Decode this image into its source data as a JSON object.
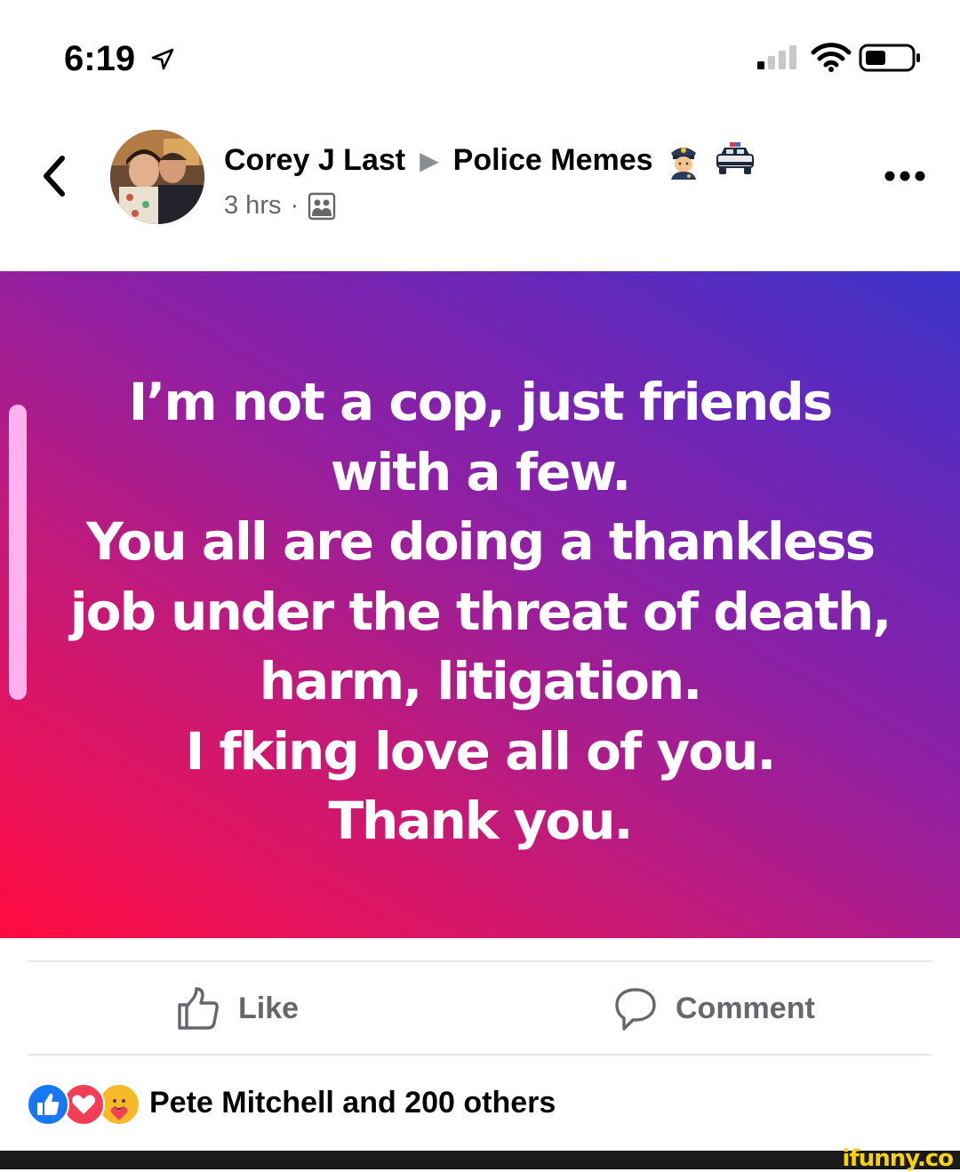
{
  "status_bar": {
    "time": "6:19"
  },
  "post": {
    "author": "Corey J Last",
    "group": "Police Memes",
    "time_ago": "3 hrs",
    "separator": "·",
    "body_lines": [
      "I’m not a cop, just friends",
      "with a few.",
      "You all are doing a thankless",
      "job under the threat of death,",
      "harm, litigation.",
      "I fking love all of you.",
      "Thank you."
    ]
  },
  "actions": {
    "like_label": "Like",
    "comment_label": "Comment"
  },
  "reactions": {
    "summary": "Pete Mitchell and 200 others",
    "icons": [
      "like-reaction-icon",
      "love-reaction-icon",
      "care-reaction-icon"
    ]
  },
  "watermark": "ifunny.co",
  "colors": {
    "secondary_text": "#65676b",
    "like_blue": "#1877f2",
    "love_red": "#f33e58",
    "care_yellow": "#f7b928",
    "gradient_start": "#ff0a3e",
    "gradient_end": "#3a33c8"
  }
}
